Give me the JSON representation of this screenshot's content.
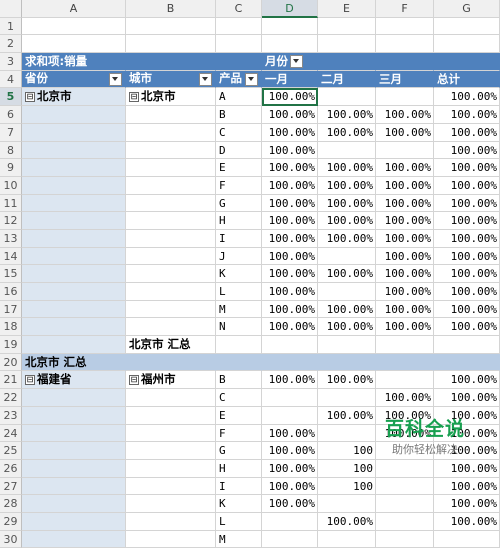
{
  "columns": [
    "A",
    "B",
    "C",
    "D",
    "E",
    "F",
    "G"
  ],
  "active_cell": "D5",
  "pivot": {
    "value_label": "求和项:销量",
    "col_field": "月份",
    "row_fields": [
      "省份",
      "城市",
      "产品"
    ],
    "months": [
      "一月",
      "二月",
      "三月"
    ],
    "grand_total_label": "总计",
    "collapse_symbol": "⊟"
  },
  "rows": [
    {
      "n": "5",
      "a": "北京市",
      "b": "北京市",
      "c": "A",
      "d": "100.00%",
      "e": "",
      "f": "",
      "g": "100.00%"
    },
    {
      "n": "6",
      "a": "",
      "b": "",
      "c": "B",
      "d": "100.00%",
      "e": "100.00%",
      "f": "100.00%",
      "g": "100.00%"
    },
    {
      "n": "7",
      "a": "",
      "b": "",
      "c": "C",
      "d": "100.00%",
      "e": "100.00%",
      "f": "100.00%",
      "g": "100.00%"
    },
    {
      "n": "8",
      "a": "",
      "b": "",
      "c": "D",
      "d": "100.00%",
      "e": "",
      "f": "",
      "g": "100.00%"
    },
    {
      "n": "9",
      "a": "",
      "b": "",
      "c": "E",
      "d": "100.00%",
      "e": "100.00%",
      "f": "100.00%",
      "g": "100.00%"
    },
    {
      "n": "10",
      "a": "",
      "b": "",
      "c": "F",
      "d": "100.00%",
      "e": "100.00%",
      "f": "100.00%",
      "g": "100.00%"
    },
    {
      "n": "11",
      "a": "",
      "b": "",
      "c": "G",
      "d": "100.00%",
      "e": "100.00%",
      "f": "100.00%",
      "g": "100.00%"
    },
    {
      "n": "12",
      "a": "",
      "b": "",
      "c": "H",
      "d": "100.00%",
      "e": "100.00%",
      "f": "100.00%",
      "g": "100.00%"
    },
    {
      "n": "13",
      "a": "",
      "b": "",
      "c": "I",
      "d": "100.00%",
      "e": "100.00%",
      "f": "100.00%",
      "g": "100.00%"
    },
    {
      "n": "14",
      "a": "",
      "b": "",
      "c": "J",
      "d": "100.00%",
      "e": "",
      "f": "100.00%",
      "g": "100.00%"
    },
    {
      "n": "15",
      "a": "",
      "b": "",
      "c": "K",
      "d": "100.00%",
      "e": "100.00%",
      "f": "100.00%",
      "g": "100.00%"
    },
    {
      "n": "16",
      "a": "",
      "b": "",
      "c": "L",
      "d": "100.00%",
      "e": "",
      "f": "100.00%",
      "g": "100.00%"
    },
    {
      "n": "17",
      "a": "",
      "b": "",
      "c": "M",
      "d": "100.00%",
      "e": "100.00%",
      "f": "100.00%",
      "g": "100.00%"
    },
    {
      "n": "18",
      "a": "",
      "b": "",
      "c": "N",
      "d": "100.00%",
      "e": "100.00%",
      "f": "100.00%",
      "g": "100.00%"
    }
  ],
  "subtotal_city": {
    "n": "19",
    "label": "北京市 汇总"
  },
  "subtotal_province": {
    "n": "20",
    "label": "北京市 汇总"
  },
  "rows2": [
    {
      "n": "21",
      "a": "福建省",
      "b": "福州市",
      "c": "B",
      "d": "100.00%",
      "e": "100.00%",
      "f": "",
      "g": "100.00%"
    },
    {
      "n": "22",
      "a": "",
      "b": "",
      "c": "C",
      "d": "",
      "e": "",
      "f": "100.00%",
      "g": "100.00%"
    },
    {
      "n": "23",
      "a": "",
      "b": "",
      "c": "E",
      "d": "",
      "e": "100.00%",
      "f": "100.00%",
      "g": "100.00%"
    },
    {
      "n": "24",
      "a": "",
      "b": "",
      "c": "F",
      "d": "100.00%",
      "e": "",
      "f": "100.00%",
      "g": "100.00%"
    },
    {
      "n": "25",
      "a": "",
      "b": "",
      "c": "G",
      "d": "100.00%",
      "e": "100",
      "f": "",
      "g": "100.00%"
    },
    {
      "n": "26",
      "a": "",
      "b": "",
      "c": "H",
      "d": "100.00%",
      "e": "100",
      "f": "",
      "g": "100.00%"
    },
    {
      "n": "27",
      "a": "",
      "b": "",
      "c": "I",
      "d": "100.00%",
      "e": "100",
      "f": "",
      "g": "100.00%"
    },
    {
      "n": "28",
      "a": "",
      "b": "",
      "c": "K",
      "d": "100.00%",
      "e": "",
      "f": "",
      "g": "100.00%"
    },
    {
      "n": "29",
      "a": "",
      "b": "",
      "c": "L",
      "d": "",
      "e": "100.00%",
      "f": "",
      "g": "100.00%"
    },
    {
      "n": "30",
      "a": "",
      "b": "",
      "c": "M",
      "d": "",
      "e": "",
      "f": "",
      "g": ""
    }
  ],
  "watermark": {
    "main": "百科全说",
    "sub": "助你轻松解决"
  }
}
